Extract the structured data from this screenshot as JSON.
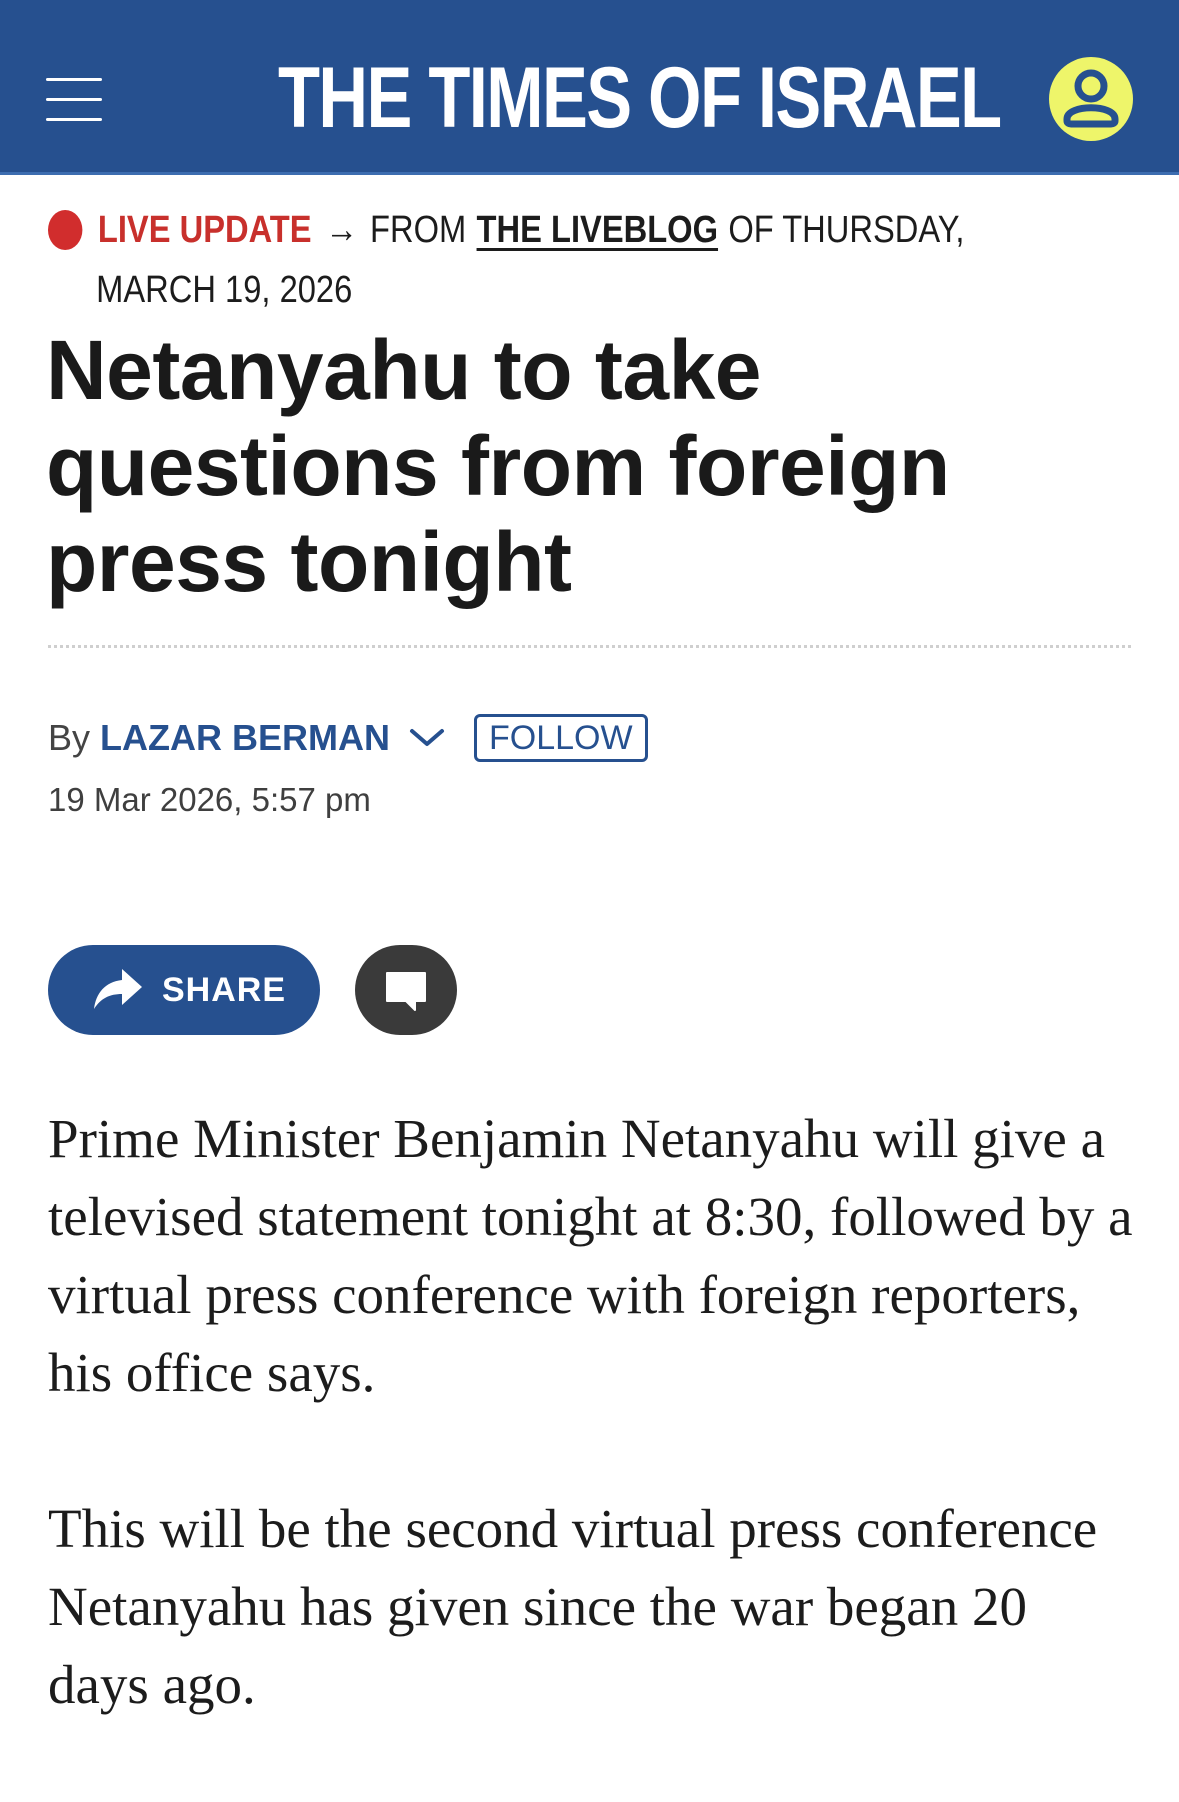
{
  "header": {
    "brand": "THE TIMES OF ISRAEL",
    "menu_icon": "hamburger-menu-icon",
    "account_icon": "user-account-icon",
    "colors": {
      "header_bg": "#26508f",
      "account_bg": "#eef56a"
    }
  },
  "kicker": {
    "live_label": "LIVE UPDATE",
    "arrow": "→",
    "from_text": "FROM",
    "liveblog_link": "THE LIVEBLOG",
    "of_text": "OF THURSDAY,",
    "date_text": "MARCH 19, 2026",
    "live_color": "#c8302c"
  },
  "article": {
    "headline": "Netanyahu to take questions from foreign press tonight",
    "byline_prefix": "By",
    "author": "LAZAR BERMAN",
    "follow_label": "FOLLOW",
    "timestamp": "19 Mar 2026, 5:57 pm",
    "paragraphs": [
      "Prime Minister Benjamin Netanyahu will give a televised statement tonight at 8:30, followed by a virtual press conference with foreign reporters, his office says.",
      "This will be the second virtual press conference Netanyahu has given since the war began 20 days ago."
    ]
  },
  "actions": {
    "share_label": "SHARE",
    "share_icon": "share-arrow-icon",
    "comment_icon": "comment-bubble-icon"
  }
}
